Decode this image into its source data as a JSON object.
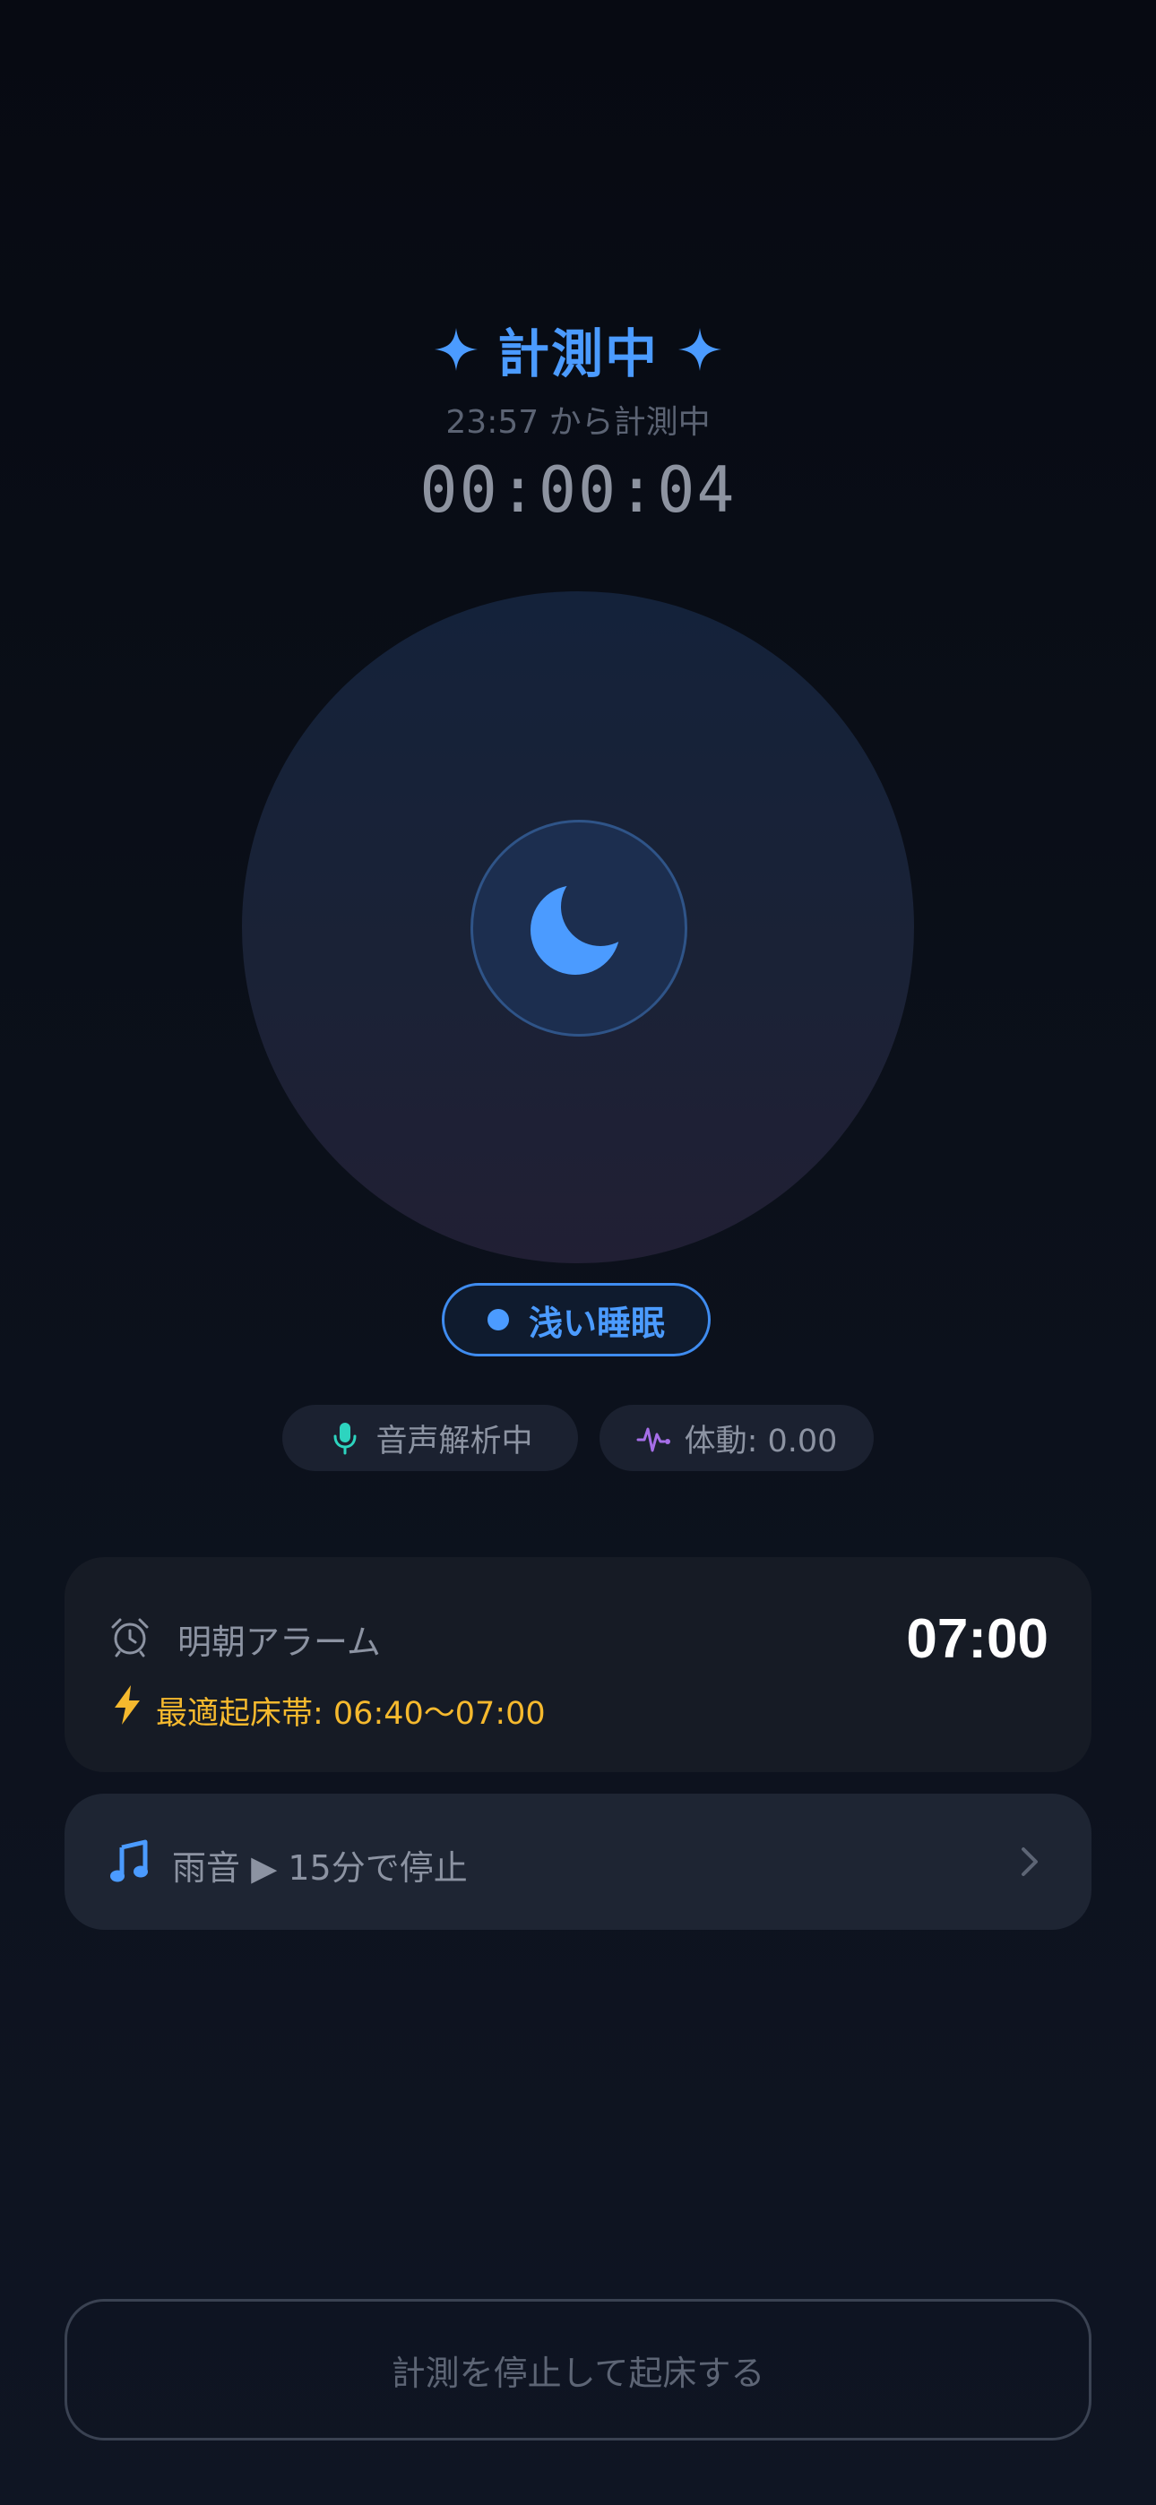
{
  "header": {
    "title": "計測中",
    "start_note": "23:57 から計測中",
    "elapsed": "00:00:04"
  },
  "orb": {
    "icon": "moon-icon",
    "accent": "#4b9bff"
  },
  "stage": {
    "label": "浅い睡眠",
    "color": "#4b9bff"
  },
  "status": {
    "audio": {
      "icon": "microphone-icon",
      "label": "音声解析中",
      "color": "#2dd4bf"
    },
    "motion": {
      "icon": "activity-icon",
      "label": "体動: 0.00",
      "color": "#a66ee8"
    }
  },
  "alarm": {
    "icon": "alarm-clock-icon",
    "label": "明朝アラーム",
    "time": "07:00",
    "optimal_window": "最適起床帯: 06:40〜07:00",
    "optimal_color": "#f5b92e"
  },
  "sound": {
    "icon": "music-note-icon",
    "label": "雨音 ▶ 15分で停止"
  },
  "stop_button": {
    "label": "計測を停止して起床する"
  }
}
